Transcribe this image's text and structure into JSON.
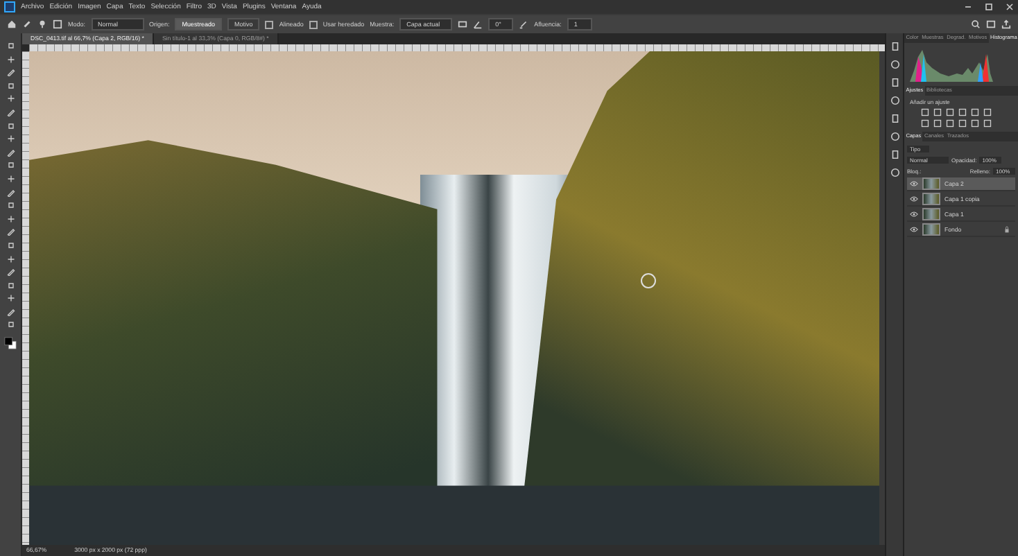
{
  "menu": [
    "Archivo",
    "Edición",
    "Imagen",
    "Capa",
    "Texto",
    "Selección",
    "Filtro",
    "3D",
    "Vista",
    "Plugins",
    "Ventana",
    "Ayuda"
  ],
  "options": {
    "mode_label": "Modo:",
    "mode": "Normal",
    "source_label": "Origen:",
    "source_buttons": [
      {
        "label": "Muestreado",
        "selected": true
      },
      {
        "label": "Motivo",
        "selected": false
      }
    ],
    "checks": [
      {
        "label": "Alineado",
        "checked": false
      },
      {
        "label": "Usar heredado",
        "checked": false
      }
    ],
    "sample_label": "Muestra:",
    "sample": "Capa actual",
    "angle": "0°",
    "flow_label": "Afluencia:",
    "flow": "1"
  },
  "doc_tabs": [
    {
      "title": "DSC_0413.tif al 66,7% (Capa 2, RGB/16) *",
      "selected": true
    },
    {
      "title": "Sin título-1 al 33,3% (Capa 0, RGB/8#) *",
      "selected": false
    }
  ],
  "top_panel": {
    "tabs": [
      {
        "label": "Color",
        "selected": false
      },
      {
        "label": "Muestras",
        "selected": false
      },
      {
        "label": "Degrad.",
        "selected": false
      },
      {
        "label": "Motivos",
        "selected": false
      },
      {
        "label": "Histograma",
        "selected": true
      }
    ]
  },
  "adjustments": {
    "tabs": [
      {
        "label": "Ajustes",
        "selected": true
      },
      {
        "label": "Bibliotecas",
        "selected": false
      }
    ],
    "hint": "Añadir un ajuste"
  },
  "layers": {
    "tabs": [
      {
        "label": "Capas",
        "selected": true
      },
      {
        "label": "Canales",
        "selected": false
      },
      {
        "label": "Trazados",
        "selected": false
      }
    ],
    "filter": "Tipo",
    "blend": "Normal",
    "opacity_label": "Opacidad:",
    "opacity": "100%",
    "lock_label": "Bloq.:",
    "fill_label": "Relleno:",
    "fill": "100%",
    "items": [
      {
        "name": "Capa 2",
        "selected": true,
        "locked": false
      },
      {
        "name": "Capa 1 copia",
        "selected": false,
        "locked": false
      },
      {
        "name": "Capa 1",
        "selected": false,
        "locked": false
      },
      {
        "name": "Fondo",
        "selected": false,
        "locked": true
      }
    ]
  },
  "status_bar": {
    "zoom": "66,67%",
    "size": "3000 px x 2000 px (72 ppp)"
  }
}
